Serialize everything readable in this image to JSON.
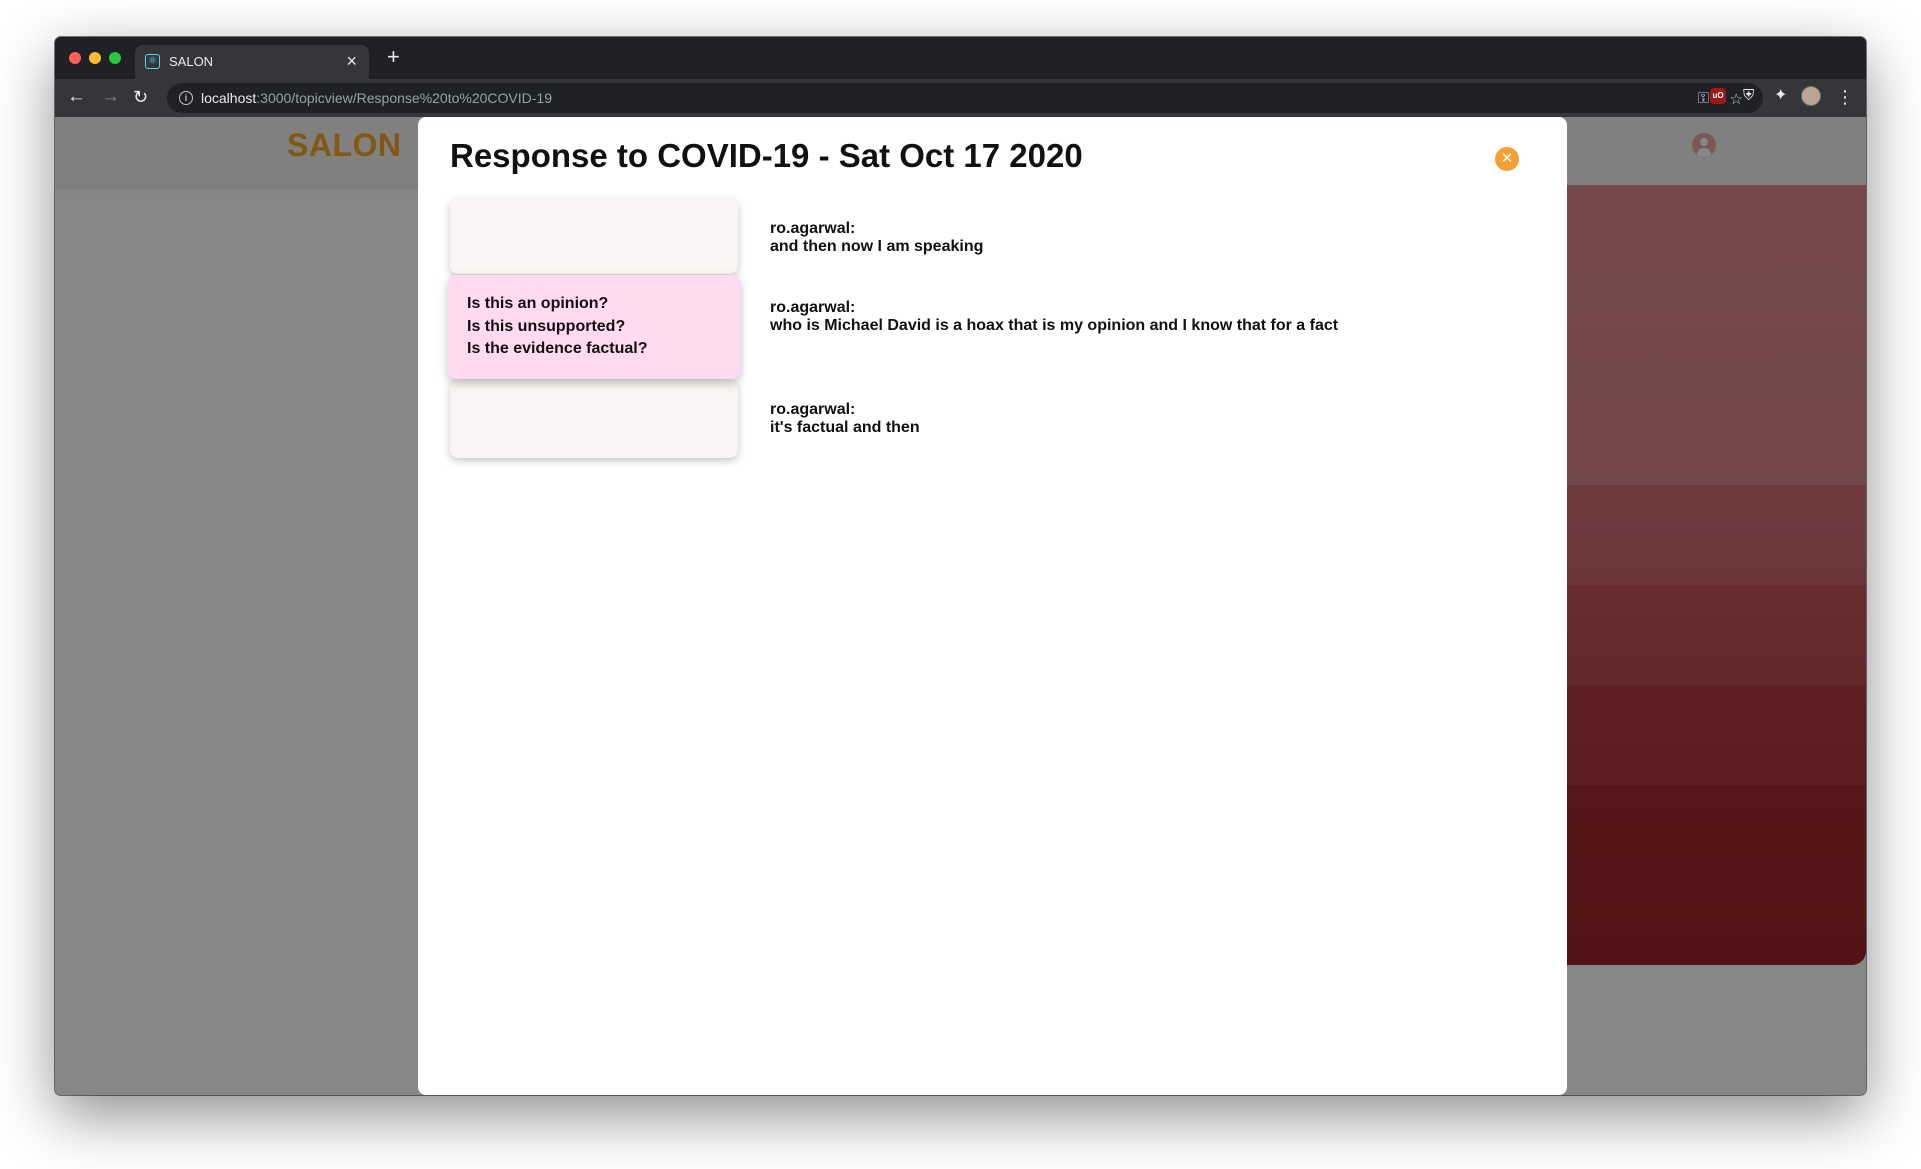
{
  "browser": {
    "tab_title": "SALON",
    "tab_close": "×",
    "new_tab": "+",
    "nav": {
      "back": "←",
      "forward": "→",
      "reload": "↻",
      "menu": "⋮"
    },
    "url_host": "localhost",
    "url_path": ":3000/topicview/Response%20to%20COVID-19",
    "icons": [
      "info-icon",
      "key-icon",
      "star-icon",
      "ublock-icon",
      "shield-icon",
      "puzzle-icon",
      "profile-avatar",
      "menu-dots-icon"
    ],
    "ublock_label": "uO"
  },
  "app": {
    "logo": "SALON",
    "accent_color": "#f5a623"
  },
  "modal": {
    "title": "Response to COVID-19 - Sat Oct 17 2020",
    "close_icon": "✕",
    "prompt_questions": [
      "Is this an opinion?",
      "Is this unsupported?",
      "Is the evidence factual?"
    ],
    "transcript": [
      {
        "speaker": "ro.agarwal:",
        "text": "and then now I am speaking"
      },
      {
        "speaker": "ro.agarwal:",
        "text": "who is Michael David is a hoax that is my opinion and I know that for a fact"
      },
      {
        "speaker": "ro.agarwal:",
        "text": "it's factual and then"
      }
    ]
  }
}
